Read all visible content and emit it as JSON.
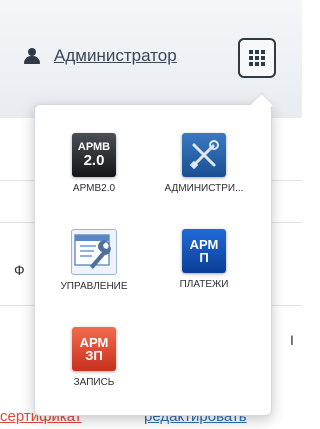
{
  "header": {
    "user_name": "Администратор"
  },
  "background": {
    "letter_left": "Ф",
    "letter_right": "I",
    "link_red": "сертификат",
    "link_blue": "редактировать"
  },
  "apps_menu": {
    "items": [
      {
        "label": "АРМВ2.0",
        "icon_text_1": "АРМВ",
        "icon_text_2": "2.0"
      },
      {
        "label": "АДМИНИСТРИ..."
      },
      {
        "label": "УПРАВЛЕНИЕ"
      },
      {
        "label": "ПЛАТЕЖИ",
        "icon_text_1": "АРМ",
        "icon_text_2": "П"
      },
      {
        "label": "ЗАПИСЬ",
        "icon_text_1": "АРМ",
        "icon_text_2": "ЗП"
      }
    ]
  }
}
